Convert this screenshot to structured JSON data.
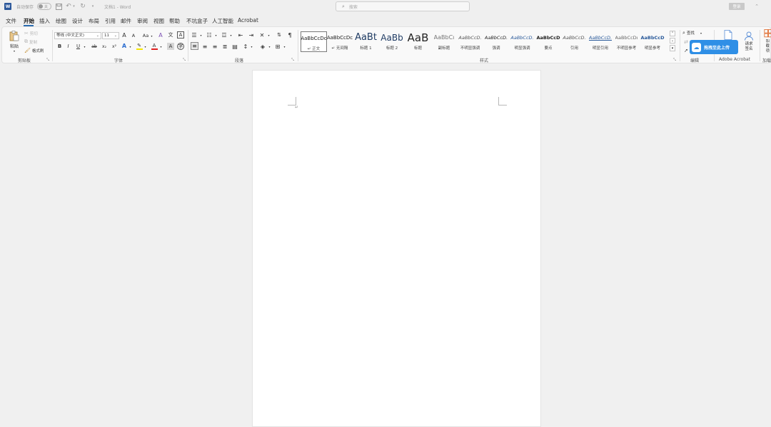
{
  "titlebar": {
    "autosave_label": "自动保存",
    "autosave_state": "关",
    "doc_title": "文档1 - Word",
    "search_placeholder": "搜索",
    "login_label": "登录"
  },
  "menu": {
    "items": [
      "文件",
      "开始",
      "插入",
      "绘图",
      "设计",
      "布局",
      "引用",
      "邮件",
      "审阅",
      "视图",
      "帮助",
      "不坑盒子",
      "人工智能",
      "Acrobat"
    ],
    "active_index": 1
  },
  "clipboard": {
    "paste": "粘贴",
    "cut": "剪切",
    "copy": "复制",
    "format_painter": "格式刷",
    "group": "剪贴板"
  },
  "font": {
    "name": "等线 (中文正文)",
    "size": "11",
    "group": "字体",
    "grow": "A",
    "shrink": "A",
    "change_case": "Aa",
    "clear": "A",
    "bold": "B",
    "italic": "I",
    "underline": "U",
    "strike": "ab",
    "subscript": "x₂",
    "superscript": "x²",
    "effects": "A",
    "font_color": "A",
    "char_shading": "A"
  },
  "paragraph": {
    "group": "段落"
  },
  "styles": {
    "group": "样式",
    "items": [
      {
        "preview": "AaBbCcDc",
        "label": "↵ 正文"
      },
      {
        "preview": "AaBbCcDc",
        "label": "↵ 无间隔"
      },
      {
        "preview": "AaBt",
        "label": "标题 1"
      },
      {
        "preview": "AaBb",
        "label": "标题 2"
      },
      {
        "preview": "AaB",
        "label": "标题"
      },
      {
        "preview": "AaBbCı",
        "label": "副标题"
      },
      {
        "preview": "AaBbCcD.",
        "label": "不明显强调"
      },
      {
        "preview": "AaBbCcD.",
        "label": "强调"
      },
      {
        "preview": "AaBbCcD.",
        "label": "明显强调"
      },
      {
        "preview": "AaBbCcD",
        "label": "要点"
      },
      {
        "preview": "AaBbCcD.",
        "label": "引用"
      },
      {
        "preview": "AaBbCcD.",
        "label": "明显引用"
      },
      {
        "preview": "AaBbCcDı",
        "label": "不明显参考"
      },
      {
        "preview": "AaBbCcD",
        "label": "明显参考"
      }
    ]
  },
  "editing": {
    "find": "查找",
    "group": "编辑"
  },
  "upload_badge": "拖拽至此上传",
  "acrobat": {
    "sign_label": "请求签名",
    "group": "Adobe Acrobat",
    "addin_label": "加载项",
    "addin_group": "加载"
  }
}
